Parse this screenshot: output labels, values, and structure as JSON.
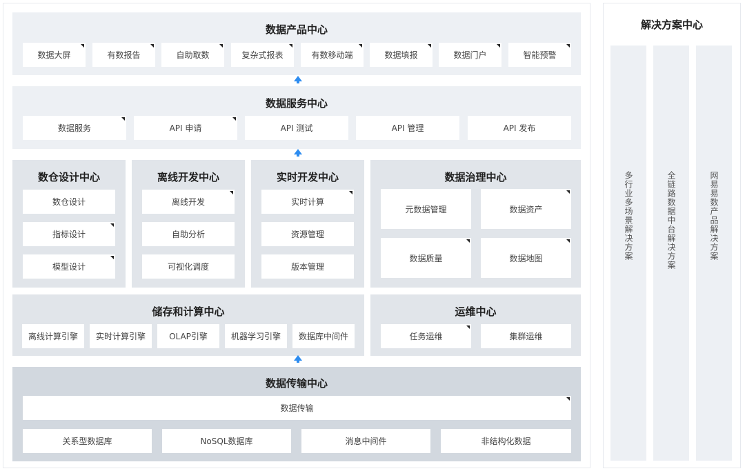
{
  "product_center": {
    "title": "数据产品中心",
    "items": [
      "数据大屏",
      "有数报告",
      "自助取数",
      "复杂式报表",
      "有数移动端",
      "数据填报",
      "数据门户",
      "智能预警"
    ]
  },
  "service_center": {
    "title": "数据服务中心",
    "items": [
      "数据服务",
      "API 申请",
      "API 测试",
      "API 管理",
      "API 发布"
    ]
  },
  "warehouse_design": {
    "title": "数仓设计中心",
    "items": [
      "数仓设计",
      "指标设计",
      "模型设计"
    ]
  },
  "offline_dev": {
    "title": "离线开发中心",
    "items": [
      "离线开发",
      "自助分析",
      "可视化调度"
    ]
  },
  "realtime_dev": {
    "title": "实时开发中心",
    "items": [
      "实时计算",
      "资源管理",
      "版本管理"
    ]
  },
  "governance": {
    "title": "数据治理中心",
    "items": [
      "元数据管理",
      "数据资产",
      "数据质量",
      "数据地图"
    ]
  },
  "storage_compute": {
    "title": "储存和计算中心",
    "items": [
      "离线计算引擎",
      "实时计算引擎",
      "OLAP引擎",
      "机器学习引擎",
      "数据库中间件"
    ]
  },
  "ops_center": {
    "title": "运维中心",
    "items": [
      "任务运维",
      "集群运维"
    ]
  },
  "transfer_center": {
    "title": "数据传输中心",
    "main": "数据传输",
    "items": [
      "关系型数据库",
      "NoSQL数据库",
      "消息中间件",
      "非结构化数据"
    ]
  },
  "solutions": {
    "title": "解决方案中心",
    "columns": [
      "多行业多场景解决方案",
      "全链路数据中台解决方案",
      "网易易数产品解决方案"
    ]
  },
  "colors": {
    "arrow": "#2d8cf0",
    "panel_light": "#edf0f4",
    "panel_dark": "#d2d8df"
  }
}
